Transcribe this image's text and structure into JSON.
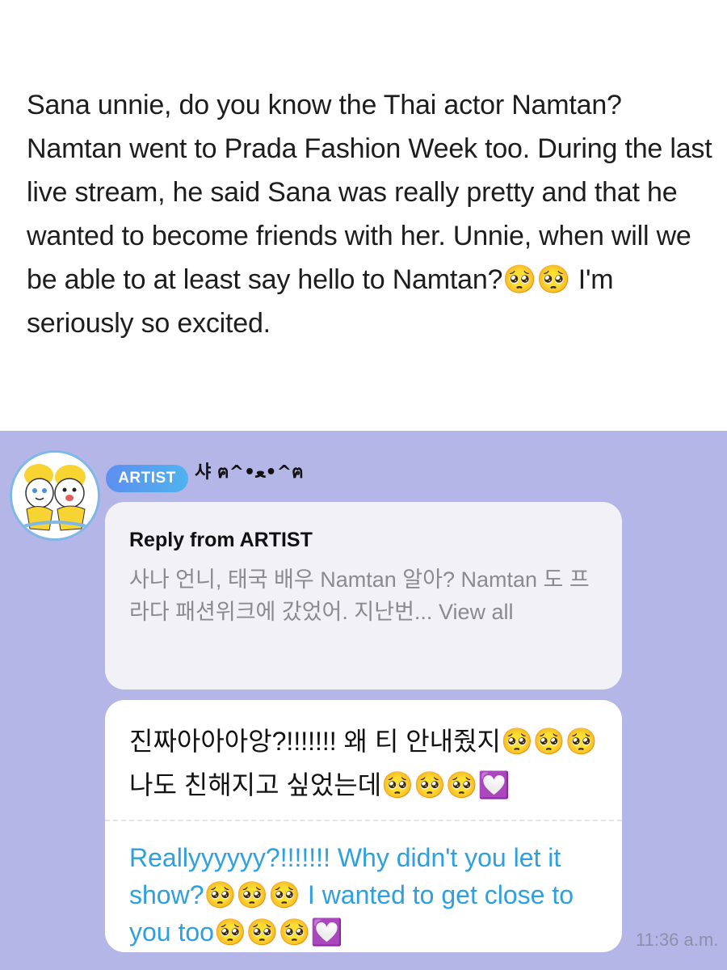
{
  "post": {
    "text": "Sana unnie, do you know the Thai actor Namtan? Namtan went to Prada Fashion Week too. During the last live stream, he said Sana was really pretty and that he wanted to become friends with her. Unnie, when will we be able to at least say hello to Namtan?🥺🥺 I'm seriously so excited."
  },
  "chat": {
    "artist_badge": "ARTIST",
    "artist_name": "샤 ฅ^•ﻌ•^ฅ",
    "reply": {
      "title": "Reply from ARTIST",
      "preview": "사나 언니, 태국 배우 Namtan 알아? Namtan 도 프라다 패션위크에 갔었어. 지난번...",
      "view_all": "View all"
    },
    "message": {
      "original": "진짜아아아앙?!!!!!!! 왜 티 안내줬지🥺🥺🥺 나도 친해지고 싶었는데🥺🥺🥺💟",
      "translation": "Reallyyyyyy?!!!!!!! Why didn't you let it show?🥺🥺🥺 I wanted to get close to you too🥺🥺🥺💟"
    },
    "time": "11:36 a.m."
  },
  "colors": {
    "chat_background": "#b5b6e8",
    "translation_text": "#2e9fdf",
    "badge_gradient_start": "#5d8ff0",
    "badge_gradient_end": "#4fb3ee"
  }
}
